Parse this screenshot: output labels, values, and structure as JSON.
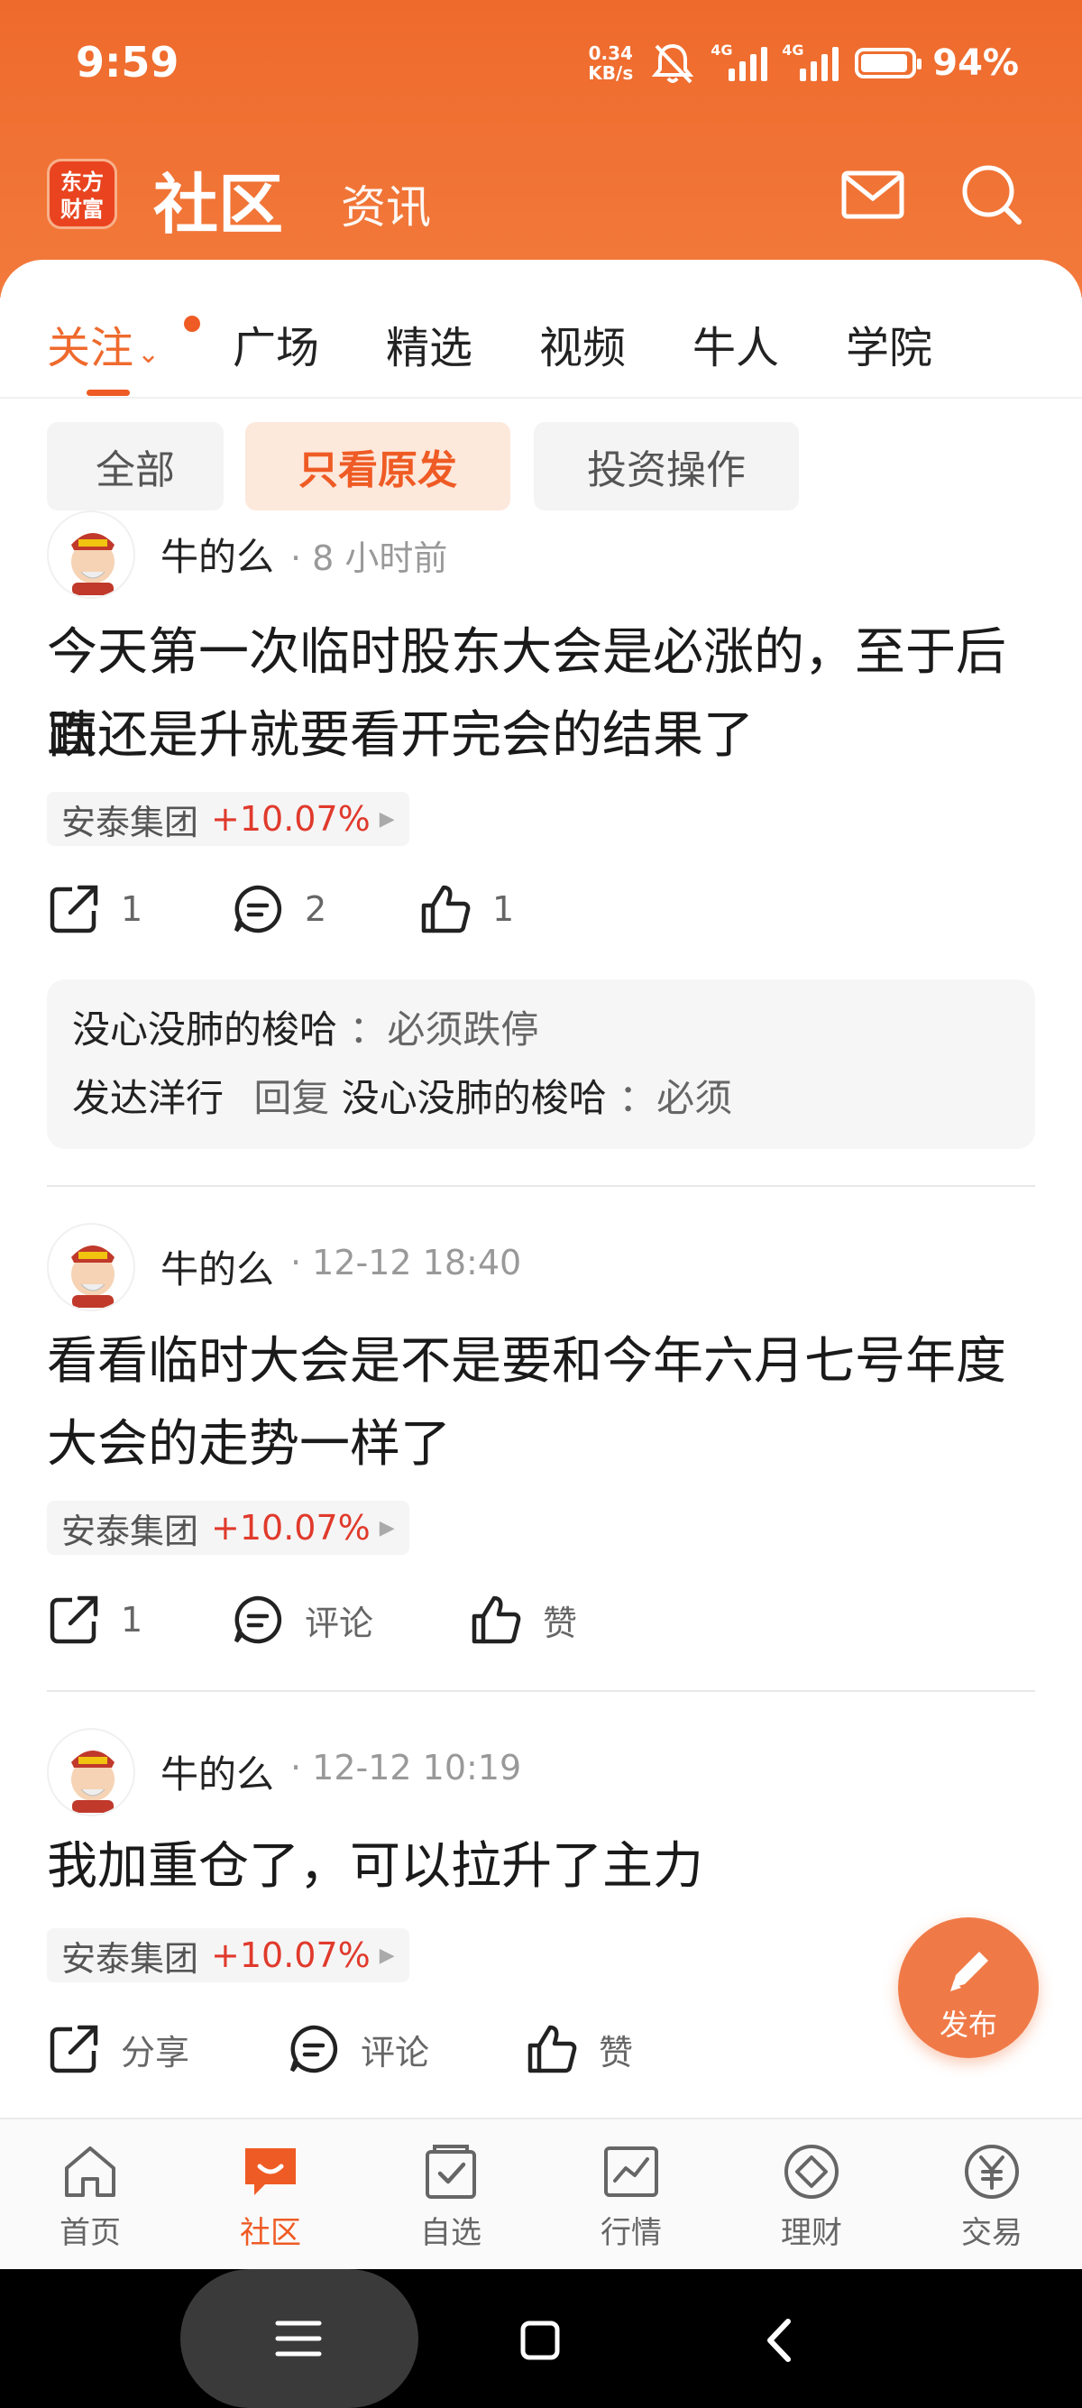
{
  "status_bar": {
    "time": "9:59",
    "net_speed_value": "0.34",
    "net_speed_unit": "KB/s",
    "signal1_tag": "4G",
    "signal2_tag": "4G",
    "battery_text": "94%"
  },
  "header": {
    "logo_line1": "东方",
    "logo_line2": "财富",
    "title": "社区",
    "subtitle": "资讯",
    "icons": [
      "mail-icon",
      "search-icon"
    ]
  },
  "tabs": [
    {
      "label": "关注",
      "active": true
    },
    {
      "label": "广场"
    },
    {
      "label": "精选"
    },
    {
      "label": "视频"
    },
    {
      "label": "牛人"
    },
    {
      "label": "学院"
    }
  ],
  "filters": [
    {
      "label": "全部"
    },
    {
      "label": "只看原发",
      "active": true
    },
    {
      "label": "投资操作"
    }
  ],
  "posts": [
    {
      "author": "牛的么",
      "time": "· 8 小时前",
      "text_line1": "今天第一次临时股东大会是必涨的，至于后面",
      "text_line2": "跌还是升就要看开完会的结果了",
      "stock_name": "安泰集团",
      "stock_change": "+10.07%",
      "share": "1",
      "comment": "2",
      "like": "1",
      "comments": [
        {
          "user": "没心没肺的梭哈",
          "sep": "：",
          "text": "必须跌停"
        },
        {
          "user": "发达洋行",
          "reply_label": "回复",
          "reply_to": "没心没肺的梭哈",
          "sep": "：",
          "text": "必须"
        }
      ]
    },
    {
      "author": "牛的么",
      "time": "· 12-12 18:40",
      "text_line1": "看看临时大会是不是要和今年六月七号年度",
      "text_line2": "大会的走势一样了",
      "stock_name": "安泰集团",
      "stock_change": "+10.07%",
      "share": "1",
      "comment": "评论",
      "like": "赞"
    },
    {
      "author": "牛的么",
      "time": "· 12-12 10:19",
      "text_line1": "我加重仓了，可以拉升了主力",
      "stock_name": "安泰集团",
      "stock_change": "+10.07%",
      "share": "分享",
      "comment": "评论",
      "like": "赞"
    }
  ],
  "fab": {
    "label": "发布",
    "icon": "pencil-icon"
  },
  "bottom_nav": [
    {
      "label": "首页",
      "icon": "home-icon"
    },
    {
      "label": "社区",
      "icon": "community-icon",
      "active": true
    },
    {
      "label": "自选",
      "icon": "watchlist-icon"
    },
    {
      "label": "行情",
      "icon": "market-icon"
    },
    {
      "label": "理财",
      "icon": "finance-icon"
    },
    {
      "label": "交易",
      "icon": "trade-icon"
    }
  ],
  "colors": {
    "accent": "#ef5b24",
    "header": "#ee6a2c",
    "stock_up": "#e03a2c"
  }
}
